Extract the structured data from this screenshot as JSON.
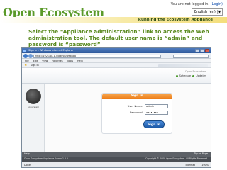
{
  "site": {
    "logo": "Open Ecosystem",
    "login_status": "You are not logged in.",
    "login_link": "(Login)",
    "language": "English (en)",
    "section_title": "Running the Ecosystem Appliance"
  },
  "instructions": "Select the “Appliance administration” link to access the Web administration tool. The default user name is “admin” and password is “password”",
  "browser": {
    "window_title": "Sign In - Windows Internet Explorer",
    "address": "http://192.168.1.5/admin/webapp",
    "menu": [
      "File",
      "Edit",
      "View",
      "Favorites",
      "Tools",
      "Help"
    ],
    "favorites_tab": "Sign In",
    "status_text": "Done",
    "zone": "Internet",
    "zoom": "100%"
  },
  "app": {
    "brand": "Open Ecosystem",
    "links": [
      "Schedule",
      "Updates"
    ],
    "avatar_label": "ecosystem",
    "signin_title": "Sign In",
    "username_label": "User Name:",
    "username_value": "admin",
    "password_label": "Password:",
    "password_value": "••••••••",
    "signin_button": "Sign In",
    "footer_help": "Help",
    "footer_top": "Top of Page",
    "footer_version": "Open Ecosystem Appliance Admin 1.0.0",
    "footer_copyright": "Copyright © 2009 Open Ecosystem. All Rights Reserved."
  },
  "colors": {
    "logo_green": "#5a9a2a",
    "instruction_green": "#5a8a20",
    "signin_orange": "#ec7d17",
    "button_blue": "#1d5aa8"
  }
}
